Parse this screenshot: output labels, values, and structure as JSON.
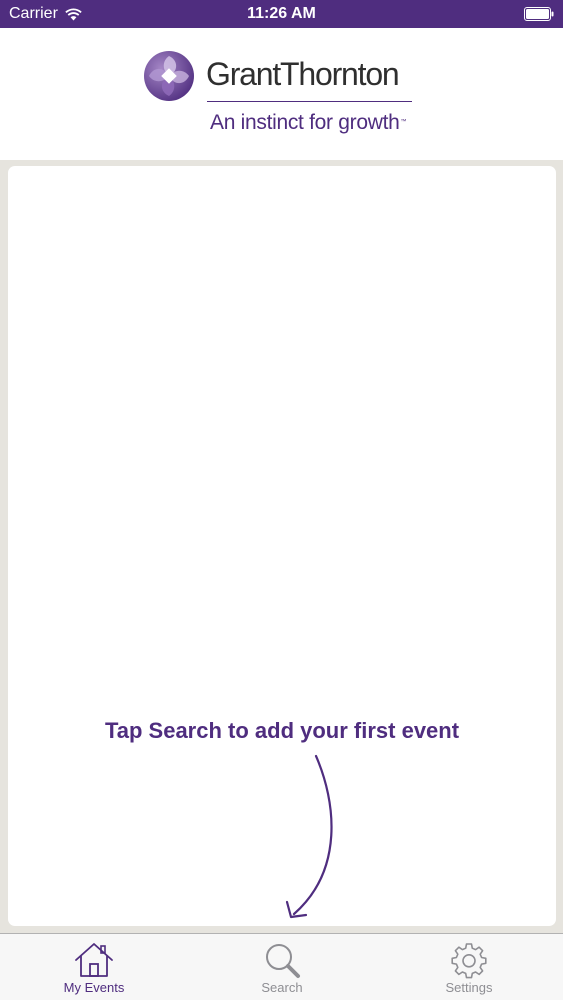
{
  "status_bar": {
    "carrier": "Carrier",
    "time": "11:26 AM",
    "icons": [
      "wifi-icon",
      "battery-icon"
    ],
    "background": "#4f2d7f"
  },
  "header": {
    "logo_name": "GrantThornton",
    "tagline": "An instinct for growth",
    "trademark": "™"
  },
  "main": {
    "hint": "Tap Search to add your first event",
    "hint_icon": "curved-arrow-icon"
  },
  "tab_bar": {
    "tabs": [
      {
        "label": "My Events",
        "icon": "home-icon",
        "active": true
      },
      {
        "label": "Search",
        "icon": "search-icon",
        "active": false
      },
      {
        "label": "Settings",
        "icon": "gear-icon",
        "active": false
      }
    ]
  },
  "colors": {
    "brand": "#4f2d7f",
    "inactive": "#8e8e93",
    "page_background": "#e6e4de"
  }
}
